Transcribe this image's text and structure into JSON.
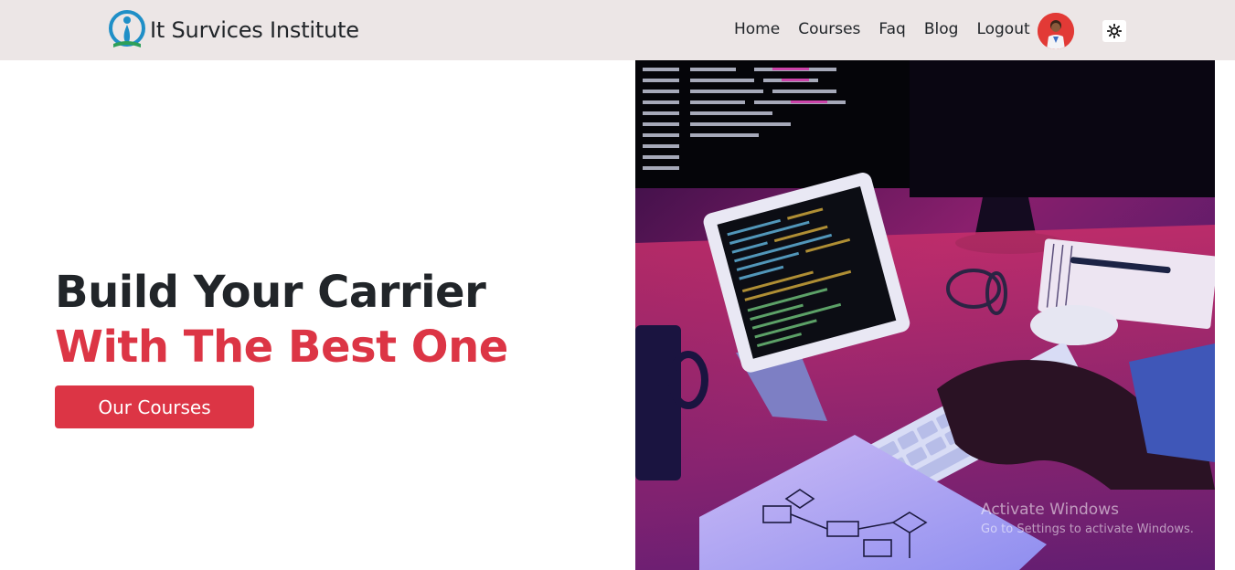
{
  "brand": {
    "name": "It Survices Institute",
    "logo_icon": "person-book-logo-icon"
  },
  "nav": {
    "items": [
      {
        "label": "Home"
      },
      {
        "label": "Courses"
      },
      {
        "label": "Faq"
      },
      {
        "label": "Blog"
      },
      {
        "label": "Logout"
      }
    ]
  },
  "user": {
    "avatar_icon": "user-avatar"
  },
  "theme_toggle": {
    "icon": "sun-icon"
  },
  "hero": {
    "title_line1": "Build Your Carrier",
    "title_line2": "With The Best One",
    "cta_label": "Our Courses",
    "image_icon": "developer-desk-photo"
  },
  "watermark": {
    "title": "Activate Windows",
    "subtitle": "Go to Settings to activate Windows."
  },
  "colors": {
    "accent": "#dc3545",
    "navbar_bg": "#ece6e6",
    "text_dark": "#212529"
  }
}
